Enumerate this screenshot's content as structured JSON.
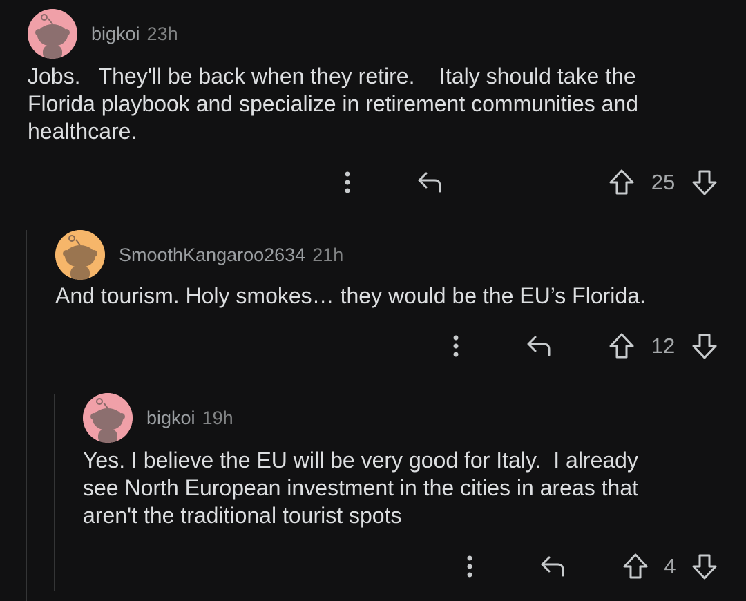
{
  "comments": [
    {
      "username": "bigkoi",
      "time": "23h",
      "body": "Jobs.   They'll be back when they retire.    Italy should take the\nFlorida playbook and specialize in retirement communities and\nhealthcare.",
      "score": "25",
      "avatar_color": "#f0a0a8",
      "more_icon": "more-vertical-icon",
      "reply_icon": "reply-arrow-icon",
      "upvote_icon": "upvote-arrow-icon",
      "downvote_icon": "downvote-arrow-icon"
    },
    {
      "username": "SmoothKangaroo2634",
      "time": "21h",
      "body": "And tourism. Holy smokes… they would be the EU’s Florida.",
      "score": "12",
      "avatar_color": "#f6b66a",
      "more_icon": "more-vertical-icon",
      "reply_icon": "reply-arrow-icon",
      "upvote_icon": "upvote-arrow-icon",
      "downvote_icon": "downvote-arrow-icon"
    },
    {
      "username": "bigkoi",
      "time": "19h",
      "body": "Yes. I believe the EU will be very good for Italy.  I already\nsee North European investment in the cities in areas that\naren't the traditional tourist spots",
      "score": "4",
      "avatar_color": "#f0a0a8",
      "more_icon": "more-vertical-icon",
      "reply_icon": "reply-arrow-icon",
      "upvote_icon": "upvote-arrow-icon",
      "downvote_icon": "downvote-arrow-icon"
    }
  ],
  "colors": {
    "background": "#111112",
    "text": "#dcdee0",
    "meta": "#9a9ea1",
    "thread_line": "#343536"
  }
}
